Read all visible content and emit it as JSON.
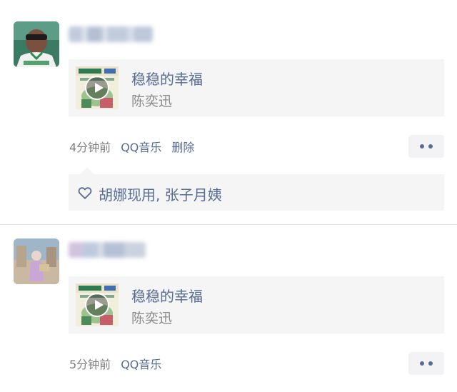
{
  "posts": [
    {
      "music": {
        "title": "稳稳的幸福",
        "artist": "陈奕迅"
      },
      "meta": {
        "time": "4分钟前",
        "source": "QQ音乐",
        "delete_label": "删除"
      },
      "likes": {
        "names": "胡娜现用, 张子月姨"
      }
    },
    {
      "music": {
        "title": "稳稳的幸福",
        "artist": "陈奕迅"
      },
      "meta": {
        "time": "5分钟前",
        "source": "QQ音乐"
      }
    }
  ],
  "colors": {
    "link_blue": "#576b95",
    "card_bg": "#f5f5f6",
    "meta_gray": "#7f7f7f"
  },
  "icons": [
    "avatar",
    "play-icon",
    "more-icon",
    "heart-icon"
  ]
}
